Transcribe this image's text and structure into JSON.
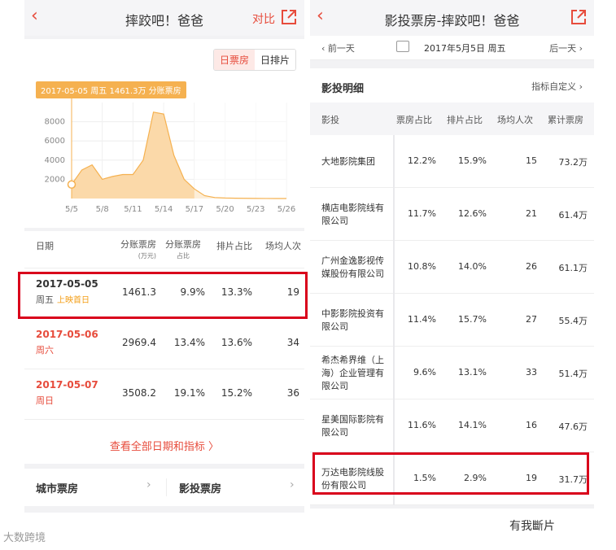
{
  "left": {
    "nav": {
      "back_icon": "chevron-left-icon",
      "title": "摔跤吧！爸爸",
      "compare": "对比",
      "share_icon": "share-icon"
    },
    "toggle": {
      "daily_box": "日票房",
      "daily_schedule": "日排片"
    },
    "tooltip": "2017-05-05 周五 1461.3万 分账票房",
    "table": {
      "headers": {
        "date": "日期",
        "box": "分账票房",
        "box_unit": "(万元)",
        "share": "分账票房",
        "share_sub": "占比",
        "schedule": "排片占比",
        "avg": "场均人次"
      },
      "rows": [
        {
          "date": "2017-05-05",
          "day": "周五",
          "tag": "上映首日",
          "box": "1461.3",
          "share": "9.9%",
          "schedule": "13.3%",
          "avg": "19"
        },
        {
          "date": "2017-05-06",
          "day": "周六",
          "tag": "",
          "box": "2969.4",
          "share": "13.4%",
          "schedule": "13.6%",
          "avg": "34"
        },
        {
          "date": "2017-05-07",
          "day": "周日",
          "tag": "",
          "box": "3508.2",
          "share": "19.1%",
          "schedule": "15.2%",
          "avg": "36"
        }
      ],
      "view_all": "查看全部日期和指标 〉"
    },
    "bottom": {
      "city": "城市票房",
      "cinema": "影投票房"
    }
  },
  "right": {
    "nav": {
      "title": "影投票房-摔跤吧！爸爸",
      "share_icon": "share-icon"
    },
    "daybar": {
      "prev": "前一天",
      "date": "2017年5月5日 周五",
      "next": "后一天"
    },
    "section": {
      "title": "影投明细",
      "config": "指标自定义"
    },
    "headers": {
      "name": "影投",
      "box_share": "票房占比",
      "schedule": "排片占比",
      "avg": "场均人次",
      "total": "累计票房"
    },
    "rows": [
      {
        "name": "大地影院集团",
        "box_share": "12.2%",
        "schedule": "15.9%",
        "avg": "15",
        "total": "73.2万"
      },
      {
        "name": "横店电影院线有限公司",
        "box_share": "11.7%",
        "schedule": "12.6%",
        "avg": "21",
        "total": "61.4万"
      },
      {
        "name": "广州金逸影视传媒股份有限公司",
        "box_share": "10.8%",
        "schedule": "14.0%",
        "avg": "26",
        "total": "61.1万"
      },
      {
        "name": "中影影院投资有限公司",
        "box_share": "11.4%",
        "schedule": "15.7%",
        "avg": "27",
        "total": "55.4万"
      },
      {
        "name": "希杰希界维（上海）企业管理有限公司",
        "box_share": "9.6%",
        "schedule": "13.1%",
        "avg": "33",
        "total": "51.4万"
      },
      {
        "name": "星美国际影院有限公司",
        "box_share": "11.6%",
        "schedule": "14.1%",
        "avg": "16",
        "total": "47.6万"
      },
      {
        "name": "万达电影院线股份有限公司",
        "box_share": "1.5%",
        "schedule": "2.9%",
        "avg": "19",
        "total": "31.7万"
      }
    ]
  },
  "watermarks": {
    "left": "大数跨境",
    "right": "有我斷片"
  },
  "colors": {
    "accent": "#e74c3c",
    "highlight": "#d9001b",
    "chart_fill": "#fbd9a9",
    "chart_line": "#f5b150"
  },
  "chart_data": {
    "type": "area",
    "x": [
      "5/5",
      "5/6",
      "5/7",
      "5/8",
      "5/9",
      "5/10",
      "5/11",
      "5/12",
      "5/13",
      "5/14",
      "5/15",
      "5/16",
      "5/17",
      "5/18",
      "5/19",
      "5/20",
      "5/21",
      "5/22",
      "5/23",
      "5/24",
      "5/25",
      "5/26"
    ],
    "values": [
      1461.3,
      2969.4,
      3508.2,
      2000,
      2300,
      2500,
      2500,
      4000,
      9000,
      8800,
      4500,
      2000,
      1000,
      300,
      100,
      50,
      30,
      20,
      10,
      5,
      3,
      2
    ],
    "highlight_from": "5/17",
    "xticks": [
      "5/5",
      "5/8",
      "5/11",
      "5/14",
      "5/17",
      "5/20",
      "5/23",
      "5/26"
    ],
    "yticks": [
      2000,
      4000,
      6000,
      8000
    ],
    "ylim": [
      0,
      10000
    ],
    "grid": true
  }
}
